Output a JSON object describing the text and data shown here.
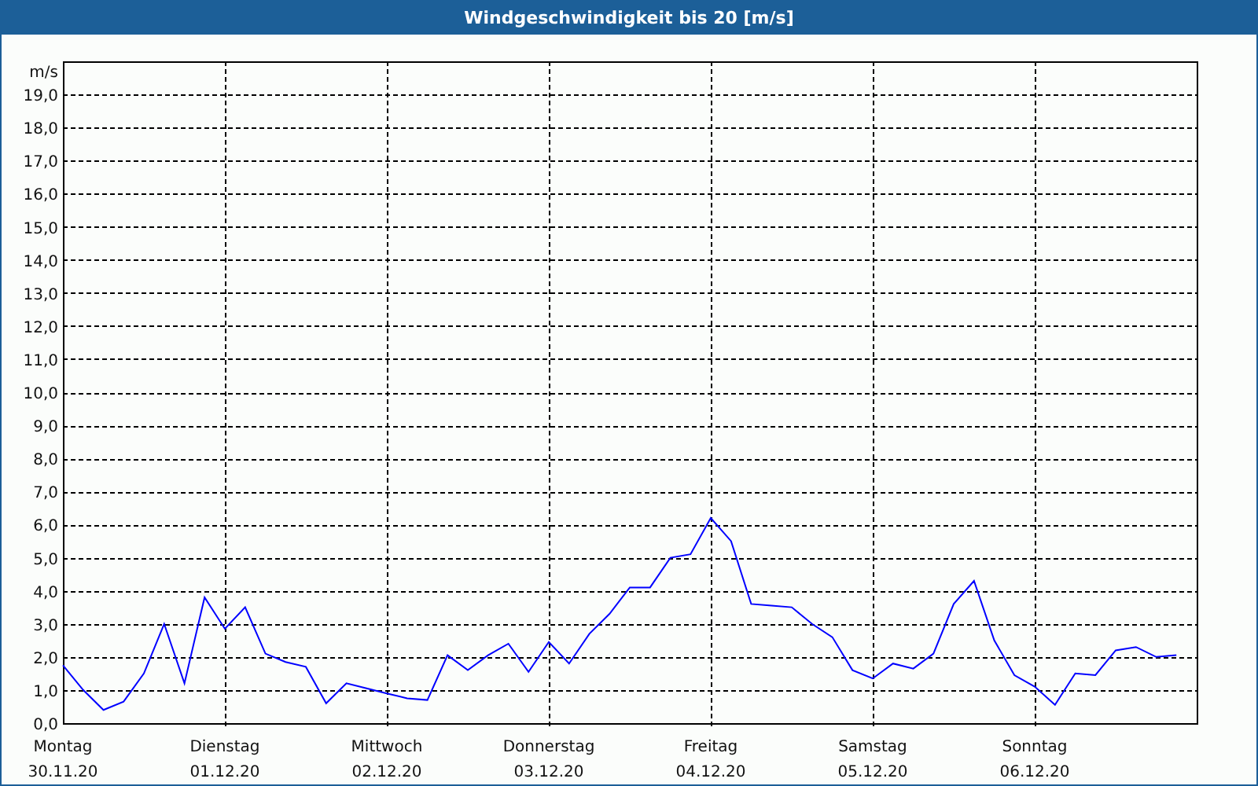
{
  "window": {
    "title": "Windgeschwindigkeit bis 20 [m/s]"
  },
  "chart": {
    "tick_dates": [
      "30.11.20",
      "01.12.20",
      "02.12.20",
      "03.12.20",
      "04.12.20",
      "05.12.20",
      "06.12.20"
    ],
    "chart_data": {
      "type": "line",
      "ylabel": "m/s",
      "grid": true,
      "ylim": [
        0,
        20
      ],
      "yticks": [
        {
          "value": 0,
          "label": "0,0"
        },
        {
          "value": 1,
          "label": "1,0"
        },
        {
          "value": 2,
          "label": "2,0"
        },
        {
          "value": 3,
          "label": "3,0"
        },
        {
          "value": 4,
          "label": "4,0"
        },
        {
          "value": 5,
          "label": "5,0"
        },
        {
          "value": 6,
          "label": "6,0"
        },
        {
          "value": 7,
          "label": "7,0"
        },
        {
          "value": 8,
          "label": "8,0"
        },
        {
          "value": 9,
          "label": "9,0"
        },
        {
          "value": 10,
          "label": "10,0"
        },
        {
          "value": 11,
          "label": "11,0"
        },
        {
          "value": 12,
          "label": "12,0"
        },
        {
          "value": 13,
          "label": "13,0"
        },
        {
          "value": 14,
          "label": "14,0"
        },
        {
          "value": 15,
          "label": "15,0"
        },
        {
          "value": 16,
          "label": "16,0"
        },
        {
          "value": 17,
          "label": "17,0"
        },
        {
          "value": 18,
          "label": "18,0"
        },
        {
          "value": 19,
          "label": "19,0"
        }
      ],
      "categories": [
        "Montag",
        null,
        null,
        null,
        null,
        null,
        null,
        null,
        "Dienstag",
        null,
        null,
        null,
        null,
        null,
        null,
        null,
        "Mittwoch",
        null,
        null,
        null,
        null,
        null,
        null,
        null,
        "Donnerstag",
        null,
        null,
        null,
        null,
        null,
        null,
        null,
        "Freitag",
        null,
        null,
        null,
        null,
        null,
        null,
        null,
        "Samstag",
        null,
        null,
        null,
        null,
        null,
        null,
        null,
        "Sonntag",
        null,
        null,
        null,
        null,
        null,
        null,
        null
      ],
      "series": [
        {
          "color": "#0000ff",
          "values": [
            1.75,
            1.0,
            0.4,
            0.65,
            1.5,
            3.0,
            1.2,
            3.8,
            2.85,
            3.5,
            2.1,
            1.85,
            1.7,
            0.6,
            1.2,
            1.05,
            0.9,
            0.75,
            0.7,
            2.05,
            1.6,
            2.05,
            2.4,
            1.55,
            2.45,
            1.8,
            2.7,
            3.3,
            4.1,
            4.1,
            5.0,
            5.1,
            6.2,
            5.5,
            3.6,
            3.55,
            3.5,
            3.0,
            2.6,
            1.6,
            1.35,
            1.8,
            1.65,
            2.1,
            3.6,
            4.3,
            2.5,
            1.45,
            1.1,
            0.55,
            1.5,
            1.45,
            2.2,
            2.3,
            2.0,
            2.05
          ]
        }
      ]
    }
  }
}
